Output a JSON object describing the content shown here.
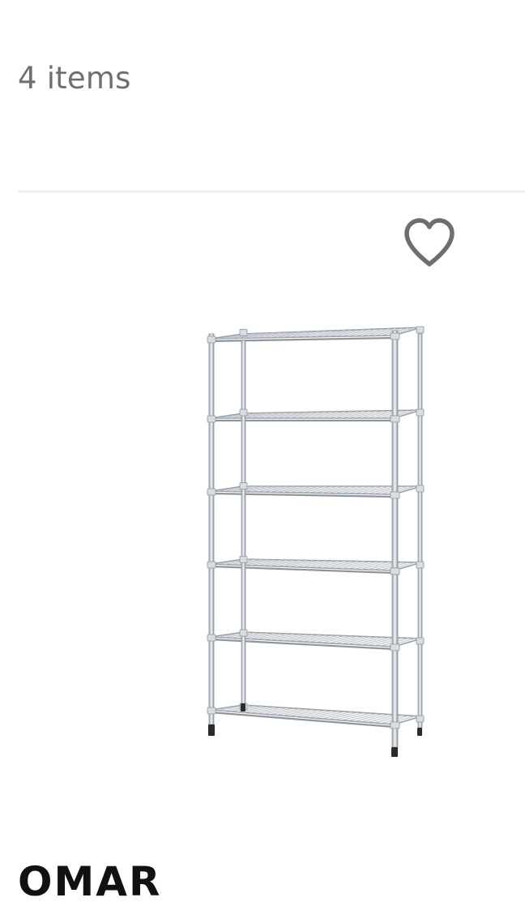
{
  "results": {
    "count_text": "4 items"
  },
  "product": {
    "name": "OMAR",
    "image_icon": "wire-shelving-unit",
    "favorite_icon": "heart-outline-icon"
  },
  "colors": {
    "count_text": "#6f6f6f",
    "divider": "#eeeeee",
    "heart": "#6e6e6e",
    "name": "#111111"
  }
}
